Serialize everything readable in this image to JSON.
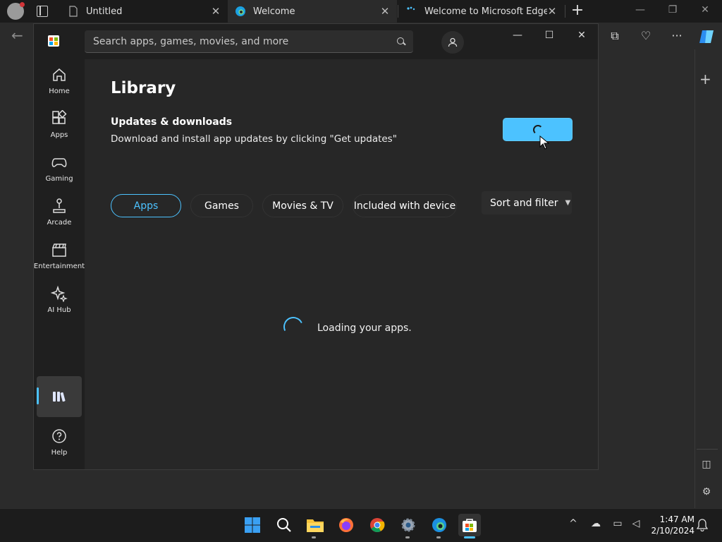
{
  "browser": {
    "tabs": [
      {
        "title": "Untitled",
        "close": "✕"
      },
      {
        "title": "Welcome",
        "close": "✕"
      },
      {
        "title": "Welcome to Microsoft Edge",
        "close": "✕"
      }
    ],
    "new_tab": "+"
  },
  "store": {
    "search_placeholder": "Search apps, games, movies, and more",
    "nav": [
      {
        "label": "Home",
        "icon": "home-icon"
      },
      {
        "label": "Apps",
        "icon": "apps-icon"
      },
      {
        "label": "Gaming",
        "icon": "gamepad-icon"
      },
      {
        "label": "Arcade",
        "icon": "joystick-icon"
      },
      {
        "label": "Entertainment",
        "icon": "clapperboard-icon"
      },
      {
        "label": "AI Hub",
        "icon": "sparkle-icon"
      }
    ],
    "help_label": "Help",
    "page_title": "Library",
    "updates_heading": "Updates & downloads",
    "updates_desc": "Download and install app updates by clicking \"Get updates\"",
    "filters": [
      "Apps",
      "Games",
      "Movies & TV",
      "Included with device"
    ],
    "sort_label": "Sort and filter",
    "loading_text": "Loading your apps.",
    "accent": "#4cc2ff"
  },
  "taskbar": {
    "time": "1:47 AM",
    "date": "2/10/2024"
  }
}
